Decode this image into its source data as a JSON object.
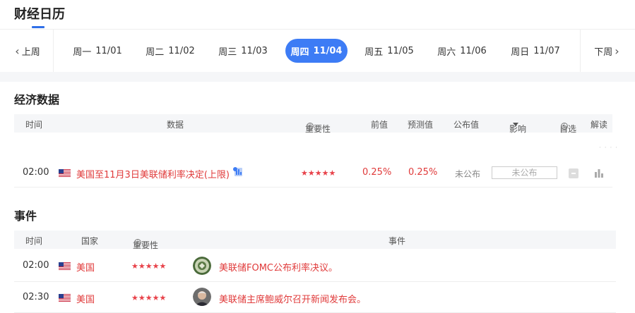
{
  "header": {
    "title": "财经日历"
  },
  "daybar": {
    "prev_label": "上周",
    "next_label": "下周",
    "days": [
      {
        "weekday": "周一",
        "date": "11/01",
        "active": false
      },
      {
        "weekday": "周二",
        "date": "11/02",
        "active": false
      },
      {
        "weekday": "周三",
        "date": "11/03",
        "active": false
      },
      {
        "weekday": "周四",
        "date": "11/04",
        "active": true
      },
      {
        "weekday": "周五",
        "date": "11/05",
        "active": false
      },
      {
        "weekday": "周六",
        "date": "11/06",
        "active": false
      },
      {
        "weekday": "周日",
        "date": "11/07",
        "active": false
      }
    ]
  },
  "economic": {
    "title": "经济数据",
    "columns": {
      "time": "时间",
      "data": "数据",
      "importance": "重要性",
      "previous": "前值",
      "forecast": "预测值",
      "actual": "公布值",
      "impact": "影响",
      "watch": "自选",
      "analysis": "解读"
    },
    "rows": [
      {
        "time": "02:00",
        "country_flag": "us-flag-icon",
        "title": "美国至11月3日美联储利率决定(上限)",
        "stars": "★★★★★",
        "previous": "0.25%",
        "forecast": "0.25%",
        "actual": "未公布",
        "impact": "未公布"
      }
    ]
  },
  "events": {
    "title": "事件",
    "columns": {
      "time": "时间",
      "country": "国家",
      "importance": "重要性",
      "event": "事件"
    },
    "rows": [
      {
        "time": "02:00",
        "country": "美国",
        "stars": "★★★★★",
        "avatar": "fed-seal-avatar",
        "event": "美联储FOMC公布利率决议。"
      },
      {
        "time": "02:30",
        "country": "美国",
        "stars": "★★★★★",
        "avatar": "powell-avatar",
        "event": "美联储主席鲍威尔召开新闻发布会。"
      }
    ]
  },
  "colors": {
    "accent": "#3d7cf5",
    "highlight": "#e03a3a",
    "header_bg": "#f5f6f8"
  }
}
